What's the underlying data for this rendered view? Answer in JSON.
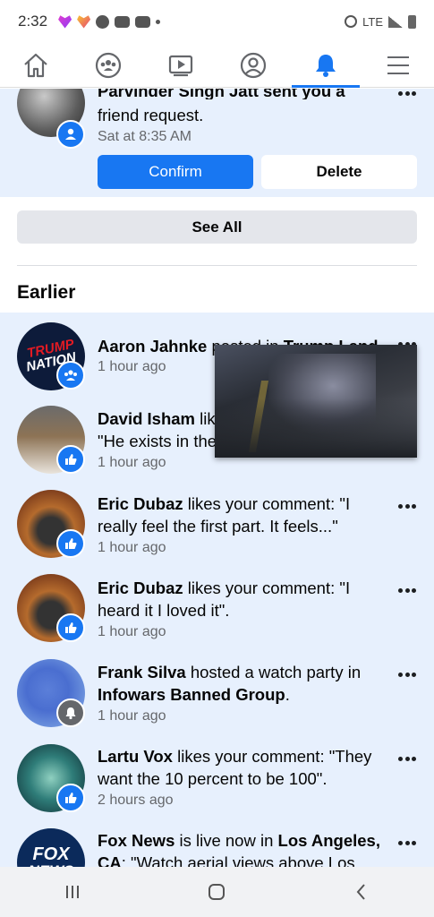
{
  "status": {
    "time": "2:32",
    "network": "LTE"
  },
  "nav": {
    "tabs": [
      {
        "name": "home",
        "icon": "home-icon"
      },
      {
        "name": "groups",
        "icon": "groups-icon"
      },
      {
        "name": "watch",
        "icon": "watch-icon"
      },
      {
        "name": "profile",
        "icon": "profile-icon"
      },
      {
        "name": "notifications",
        "icon": "bell-icon",
        "active": true
      },
      {
        "name": "menu",
        "icon": "menu-icon"
      }
    ],
    "accent": "#1877f2"
  },
  "friend_request": {
    "text_cut": "Parvinder Singh Jatt sent you a",
    "text_line2": "friend request.",
    "time": "Sat at 8:35 AM",
    "confirm_label": "Confirm",
    "delete_label": "Delete"
  },
  "see_all_label": "See All",
  "section_heading": "Earlier",
  "notifications": [
    {
      "name": "Aaron Jahnke",
      "line1": " posted in ",
      "target": "Trump Land",
      "line2": "",
      "time": "1 hour ago",
      "badge": "group-badge-icon"
    },
    {
      "name": "David Isham",
      "line1": " lik",
      "line2": "\"He exists in the",
      "time": "1 hour ago",
      "badge": "like-badge-icon"
    },
    {
      "name": "Eric Dubaz",
      "line1": " likes your comment: \"I",
      "line2": "really feel the first part. It feels...\"",
      "time": "1 hour ago",
      "badge": "like-badge-icon"
    },
    {
      "name": "Eric Dubaz",
      "line1": " likes your comment: \"I",
      "line2": "heard it I loved it\".",
      "time": "1 hour ago",
      "badge": "like-badge-icon"
    },
    {
      "name": "Frank Silva",
      "line1": " hosted a watch party in",
      "target2": "Infowars Banned Group",
      "line2": ".",
      "time": "1 hour ago",
      "badge": "watch-party-badge-icon"
    },
    {
      "name": "Lartu Vox",
      "line1": " likes your comment: \"They",
      "line2": "want the 10 percent to be 100\".",
      "time": "2 hours ago",
      "badge": "like-badge-icon"
    },
    {
      "name": "Fox News",
      "line1": " is live now in ",
      "target": "Los Angeles,",
      "target2": "CA",
      "line2": ": \"Watch aerial views above Los",
      "time": "",
      "badge": "none"
    }
  ],
  "avatar_text": {
    "trump_nation": "TRUMP NATION",
    "fox_news": "FOX NEWS"
  }
}
